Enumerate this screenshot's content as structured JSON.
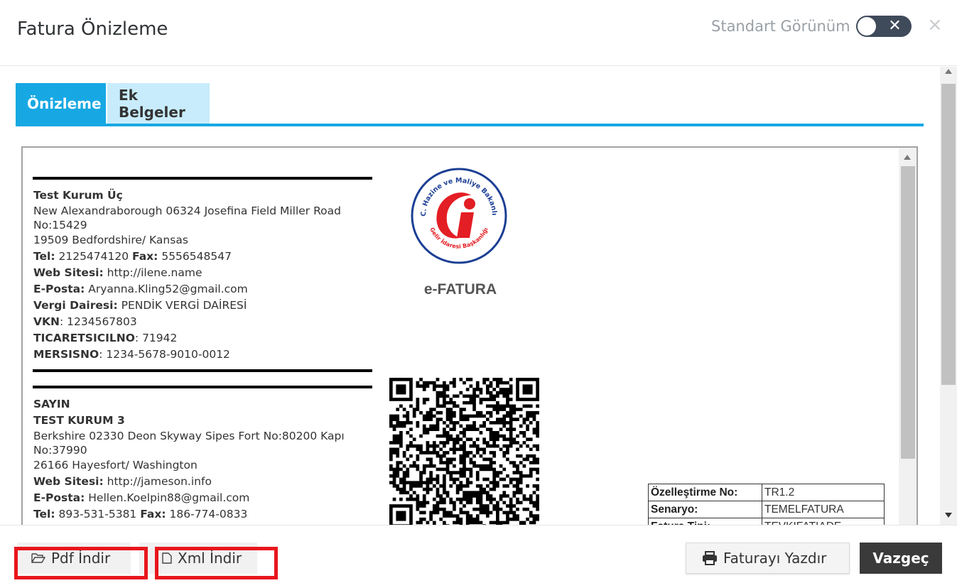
{
  "header": {
    "title": "Fatura Önizleme",
    "toggle_label": "Standart Görünüm",
    "toggle_state": "off",
    "toggle_off_glyph": "✕",
    "close_glyph": "×"
  },
  "tabs": [
    {
      "label": "Önizleme",
      "active": true
    },
    {
      "label": "Ek Belgeler",
      "active": false
    }
  ],
  "invoice": {
    "sender": {
      "name": "Test Kurum Üç",
      "address_line1": "New Alexandraborough 06324 Josefina Field Miller Road No:15429",
      "address_line2": "19509 Bedfordshire/ Kansas",
      "tel_label": "Tel:",
      "tel": "2125474120",
      "fax_label": "Fax:",
      "fax": "5556548547",
      "web_label": "Web Sitesi:",
      "web": "http://ilene.name",
      "email_label": "E-Posta:",
      "email": "Aryanna.Kling52@gmail.com",
      "tax_office_label": "Vergi Dairesi:",
      "tax_office": "PENDİK VERGİ DAİRESİ",
      "vkn_label": "VKN",
      "vkn": "1234567803",
      "ticaret_label": "TICARETSICILNO",
      "ticaret": "71942",
      "mersis_label": "MERSISNO",
      "mersis": "1234-5678-9010-0012"
    },
    "receiver": {
      "salutation": "SAYIN",
      "name": "TEST KURUM 3",
      "address_line1": "Berkshire 02330 Deon Skyway Sipes Fort No:80200 Kapı No:37990",
      "address_line2": "26166 Hayesfort/ Washington",
      "web_label": "Web Sitesi:",
      "web": "http://jameson.info",
      "email_label": "E-Posta:",
      "email": "Hellen.Koelpin88@gmail.com",
      "tel_label": "Tel:",
      "tel": "893-531-5381",
      "fax_label": "Fax:",
      "fax": "186-774-0833"
    },
    "logo": {
      "top_text": "T.C. Hazine ve Maliye Bakanlığı",
      "bottom_text": "Gelir İdaresi Başkanlığı",
      "primary_color": "#1c3f94",
      "accent_color": "#e31e24"
    },
    "efatura_label": "e-FATURA",
    "spec_table": [
      {
        "key": "Özelleştirme No:",
        "value": "TR1.2"
      },
      {
        "key": "Senaryo:",
        "value": "TEMELFATURA"
      },
      {
        "key": "Fatura Tipi:",
        "value": "TEVKIFATIADE"
      }
    ]
  },
  "footer": {
    "pdf_label": "Pdf İndir",
    "xml_label": "Xml İndir",
    "print_label": "Faturayı Yazdır",
    "cancel_label": "Vazgeç",
    "highlight_color": "#e8161c"
  }
}
